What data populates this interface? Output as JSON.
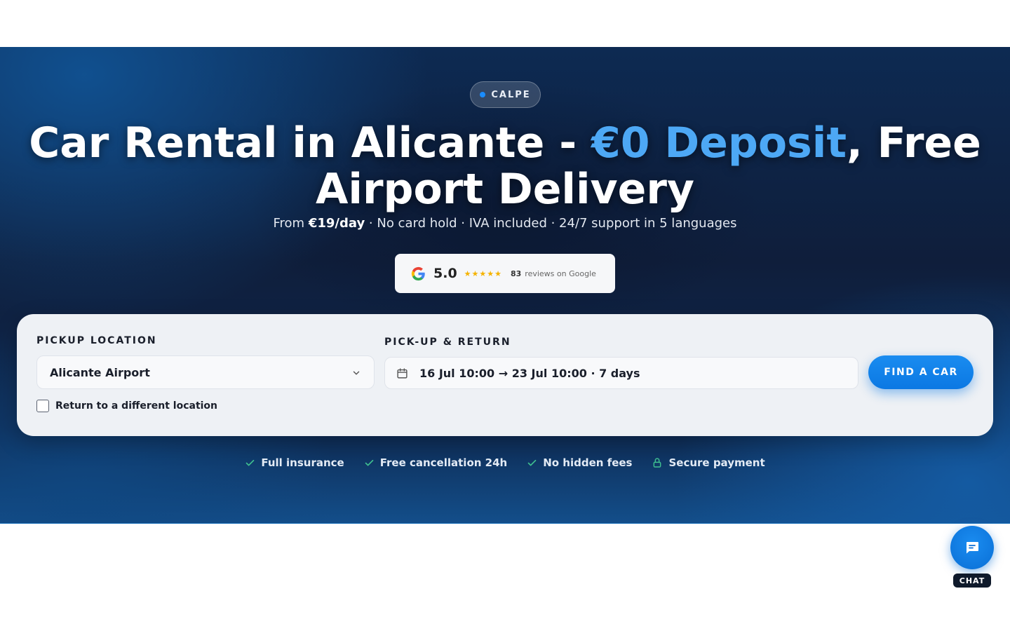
{
  "hero": {
    "badge": "CALPE",
    "headline_part1": "Car Rental in Alicante - ",
    "headline_accent": "€0 Deposit",
    "headline_part2": ", Free Airport Delivery",
    "sub_from": "From ",
    "sub_price": "€19/day",
    "sub_rest": " · No card hold · IVA included · 24/7 support in 5 languages",
    "rating": {
      "score": "5.0",
      "stars": "★★★★★",
      "count": "83",
      "suffix": "reviews on Google"
    }
  },
  "search": {
    "pickup_label": "PICKUP LOCATION",
    "pickup_value": "Alicante Airport",
    "dates_label": "PICK-UP & RETURN",
    "dates_value": "16 Jul 10:00 → 23 Jul 10:00 · 7 days",
    "return_diff_label": "Return to a different location",
    "return_diff_checked": false,
    "find_button": "FIND A CAR"
  },
  "features": [
    {
      "icon": "check-icon",
      "label": "Full insurance"
    },
    {
      "icon": "check-icon",
      "label": "Free cancellation 24h"
    },
    {
      "icon": "check-icon",
      "label": "No hidden fees"
    },
    {
      "icon": "lock-icon",
      "label": "Secure payment"
    }
  ],
  "chat": {
    "label": "CHAT",
    "icon": "chat-icon"
  },
  "colors": {
    "accent": "#4da8f5",
    "button": "#0b78e3",
    "check": "#3fbf8f"
  }
}
